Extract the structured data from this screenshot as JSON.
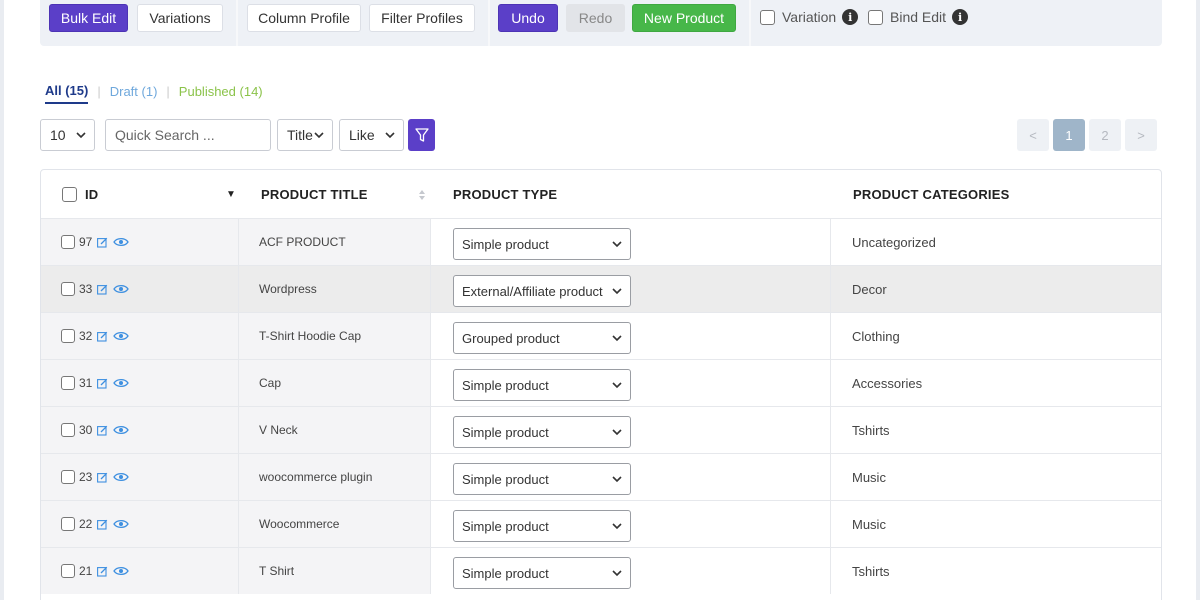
{
  "toolbar": {
    "bulk_edit": "Bulk Edit",
    "variations": "Variations",
    "column_profile": "Column Profile",
    "filter_profiles": "Filter Profiles",
    "undo": "Undo",
    "redo": "Redo",
    "new_product": "New Product",
    "variation_check": "Variation",
    "bind_edit_check": "Bind Edit",
    "info_glyph": "i"
  },
  "status_tabs": [
    {
      "label": "All (15)"
    },
    {
      "label": "Draft (1)"
    },
    {
      "label": "Published (14)"
    }
  ],
  "filters": {
    "per_page": "10",
    "search_placeholder": "Quick Search ...",
    "field": "Title",
    "operator": "Like"
  },
  "pagination": {
    "prev": "<",
    "pages": [
      "1",
      "2"
    ],
    "next": ">",
    "current": "1"
  },
  "table": {
    "columns": [
      "ID",
      "PRODUCT TITLE",
      "PRODUCT TYPE",
      "PRODUCT CATEGORIES"
    ],
    "sort_glyph": "▼",
    "rows": [
      {
        "id": "97",
        "title": "ACF PRODUCT",
        "type": "Simple product",
        "category": "Uncategorized"
      },
      {
        "id": "33",
        "title": "Wordpress",
        "type": "External/Affiliate product",
        "category": "Decor"
      },
      {
        "id": "32",
        "title": "T-Shirt Hoodie Cap",
        "type": "Grouped product",
        "category": "Clothing"
      },
      {
        "id": "31",
        "title": "Cap",
        "type": "Simple product",
        "category": "Accessories"
      },
      {
        "id": "30",
        "title": "V Neck",
        "type": "Simple product",
        "category": "Tshirts"
      },
      {
        "id": "23",
        "title": "woocommerce plugin",
        "type": "Simple product",
        "category": "Music"
      },
      {
        "id": "22",
        "title": "Woocommerce",
        "type": "Simple product",
        "category": "Music"
      },
      {
        "id": "21",
        "title": "T Shirt",
        "type": "Simple product",
        "category": "Tshirts"
      }
    ]
  },
  "colors": {
    "accent_purple": "#5b3fc8",
    "success_green": "#47b749",
    "link_blue": "#1e3a8a"
  }
}
